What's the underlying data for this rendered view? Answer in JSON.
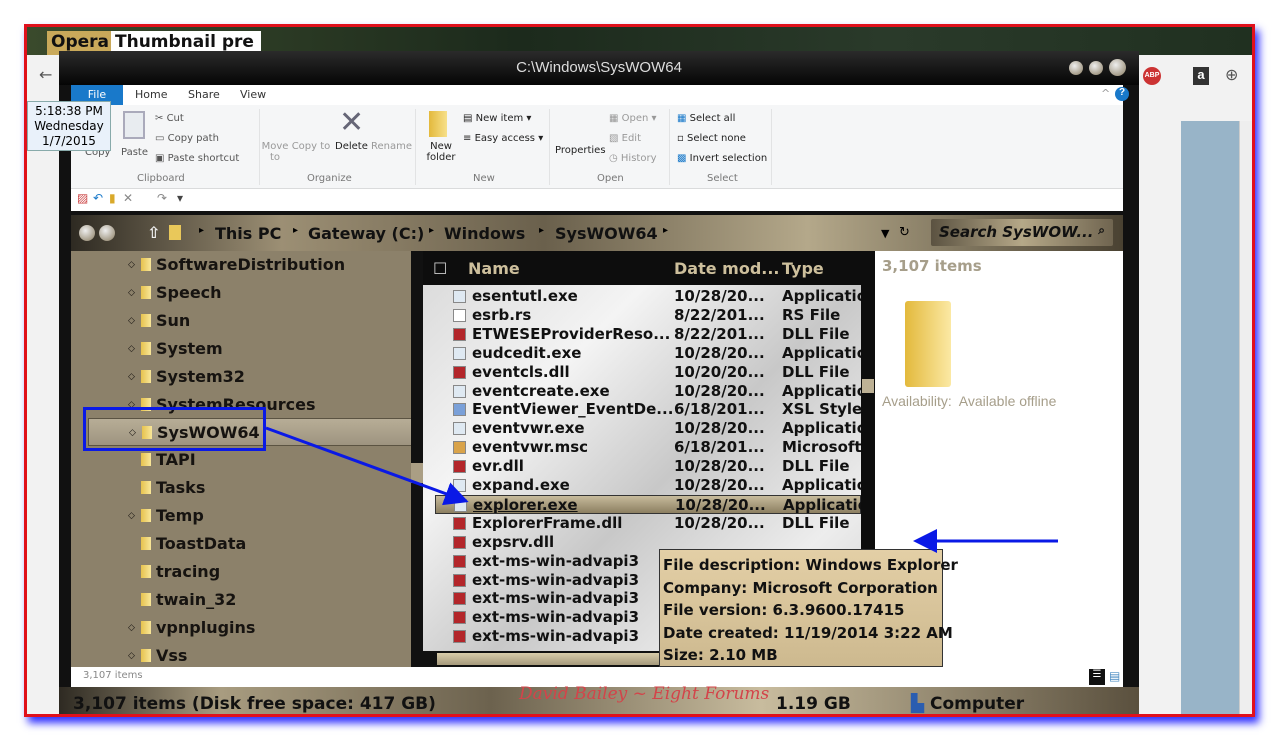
{
  "desktop": {
    "tabs": [
      {
        "label": "Opera"
      },
      {
        "label": "Thumbnail pre",
        "close": "×"
      }
    ]
  },
  "clock": {
    "time": "5:18:38 PM",
    "day": "Wednesday",
    "date": "1/7/2015"
  },
  "window": {
    "title": "C:\\Windows\\SysWOW64"
  },
  "ribbon": {
    "tabs": [
      "File",
      "Home",
      "Share",
      "View"
    ],
    "clipboard": {
      "copy": "Copy",
      "paste": "Paste",
      "cut": "Cut",
      "copy_path": "Copy path",
      "paste_shortcut": "Paste shortcut",
      "group": "Clipboard"
    },
    "organize": {
      "move_to": "Move to",
      "copy_to": "Copy to",
      "delete": "Delete",
      "rename": "Rename",
      "group": "Organize"
    },
    "new": {
      "new_folder": "New folder",
      "new_item": "New item",
      "easy_access": "Easy access",
      "group": "New"
    },
    "open": {
      "properties": "Properties",
      "open": "Open",
      "edit": "Edit",
      "history": "History",
      "group": "Open"
    },
    "select": {
      "select_all": "Select all",
      "select_none": "Select none",
      "invert": "Invert selection",
      "group": "Select"
    }
  },
  "address": {
    "crumbs": [
      "This PC",
      "Gateway (C:)",
      "Windows",
      "SysWOW64"
    ],
    "search_placeholder": "Search SysWOW..."
  },
  "nav": {
    "items": [
      {
        "label": "SoftwareDistribution",
        "exp": true
      },
      {
        "label": "Speech",
        "exp": true
      },
      {
        "label": "Sun",
        "exp": true
      },
      {
        "label": "System",
        "exp": true
      },
      {
        "label": "System32",
        "exp": true
      },
      {
        "label": "SystemResources",
        "exp": true
      },
      {
        "label": "SysWOW64",
        "exp": true,
        "selected": true
      },
      {
        "label": "TAPI",
        "exp": false
      },
      {
        "label": "Tasks",
        "exp": false
      },
      {
        "label": "Temp",
        "exp": true
      },
      {
        "label": "ToastData",
        "exp": false
      },
      {
        "label": "tracing",
        "exp": false
      },
      {
        "label": "twain_32",
        "exp": false
      },
      {
        "label": "vpnplugins",
        "exp": true
      },
      {
        "label": "Vss",
        "exp": true
      }
    ]
  },
  "list": {
    "columns": [
      "Name",
      "Date mod...",
      "Type"
    ],
    "rows": [
      {
        "name": "esentutl.exe",
        "date": "10/28/20...",
        "type": "Application",
        "icon": "exe"
      },
      {
        "name": "esrb.rs",
        "date": "8/22/201...",
        "type": "RS File",
        "icon": "file"
      },
      {
        "name": "ETWESEProviderReso...",
        "date": "8/22/201...",
        "type": "DLL File",
        "icon": "dll"
      },
      {
        "name": "eudcedit.exe",
        "date": "10/28/20...",
        "type": "Application",
        "icon": "exe"
      },
      {
        "name": "eventcls.dll",
        "date": "10/20/20...",
        "type": "DLL File",
        "icon": "dll"
      },
      {
        "name": "eventcreate.exe",
        "date": "10/28/20...",
        "type": "Application",
        "icon": "exe"
      },
      {
        "name": "EventViewer_EventDe...",
        "date": "6/18/201...",
        "type": "XSL Stylesheet",
        "icon": "xsl"
      },
      {
        "name": "eventvwr.exe",
        "date": "10/28/20...",
        "type": "Application",
        "icon": "exe"
      },
      {
        "name": "eventvwr.msc",
        "date": "6/18/201...",
        "type": "Microsoft",
        "icon": "msc"
      },
      {
        "name": "evr.dll",
        "date": "10/28/20...",
        "type": "DLL File",
        "icon": "dll"
      },
      {
        "name": "expand.exe",
        "date": "10/28/20...",
        "type": "Application",
        "icon": "exe"
      },
      {
        "name": "explorer.exe",
        "date": "10/28/20...",
        "type": "Application",
        "icon": "exe",
        "selected": true
      },
      {
        "name": "ExplorerFrame.dll",
        "date": "10/28/20...",
        "type": "DLL File",
        "icon": "dll"
      },
      {
        "name": "expsrv.dll",
        "date": "",
        "type": "",
        "icon": "dll"
      },
      {
        "name": "ext-ms-win-advapi3",
        "date": "",
        "type": "",
        "icon": "dll"
      },
      {
        "name": "ext-ms-win-advapi3",
        "date": "",
        "type": "",
        "icon": "dll"
      },
      {
        "name": "ext-ms-win-advapi3",
        "date": "",
        "type": "",
        "icon": "dll"
      },
      {
        "name": "ext-ms-win-advapi3",
        "date": "",
        "type": "",
        "icon": "dll"
      },
      {
        "name": "ext-ms-win-advapi3",
        "date": "",
        "type": "",
        "icon": "dll"
      }
    ]
  },
  "details": {
    "count": "3,107 items",
    "availability_label": "Availability:",
    "availability_value": "Available offline"
  },
  "tooltip": {
    "lines": [
      "File description: Windows Explorer",
      "Company: Microsoft Corporation",
      "File version: 6.3.9600.17415",
      "Date created: 11/19/2014 3:22 AM",
      "Size: 2.10 MB"
    ]
  },
  "status": {
    "small": "3,107 items",
    "main": "3,107 items (Disk free space: 417 GB)",
    "size": "1.19 GB",
    "location": "Computer",
    "watermark": "David Bailey ~ Eight Forums"
  },
  "colors": {
    "annotation": "#0a19e6",
    "frame": "#e0101c"
  }
}
